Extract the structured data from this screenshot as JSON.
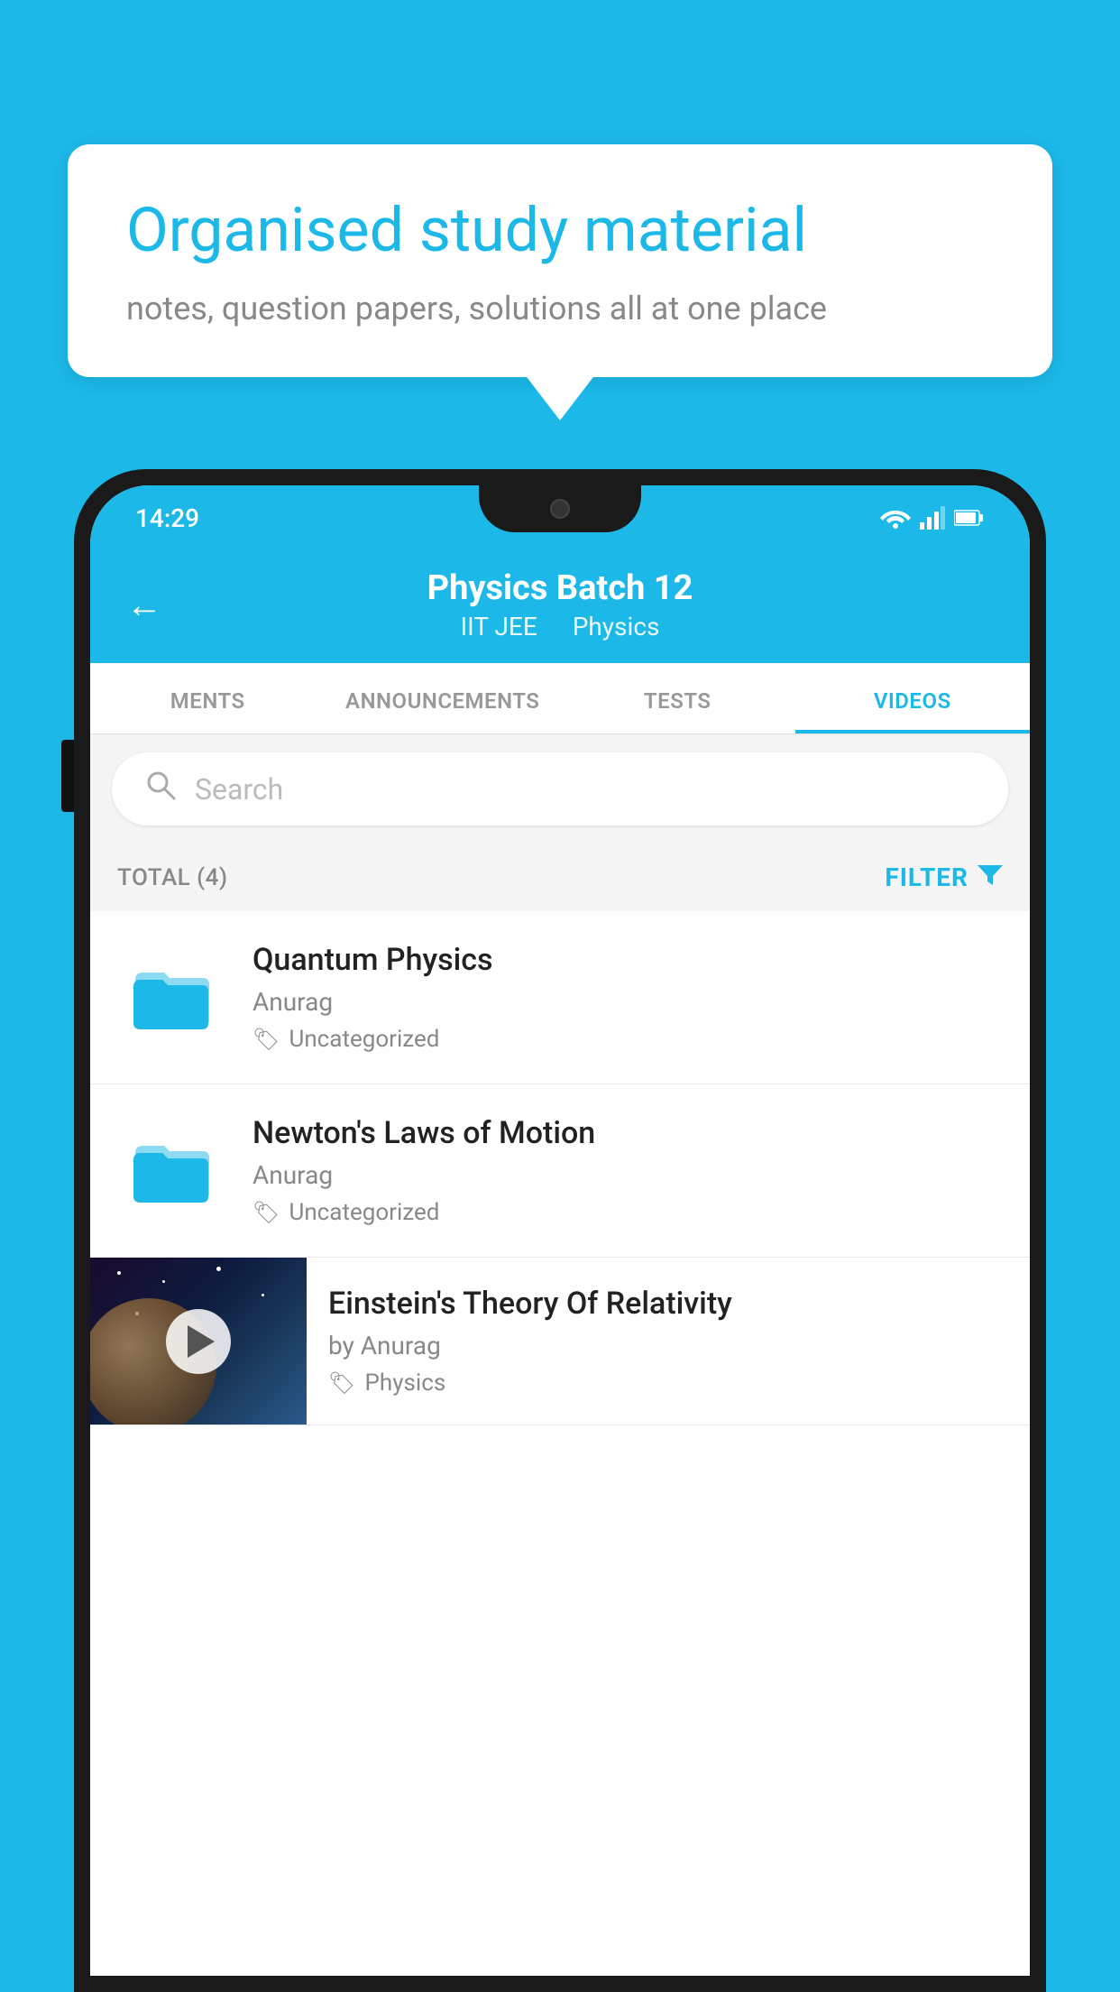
{
  "background": {
    "color": "#1BB8E8"
  },
  "speech_bubble": {
    "heading": "Organised study material",
    "subtext": "notes, question papers, solutions all at one place"
  },
  "phone": {
    "status_bar": {
      "time": "14:29",
      "icons": [
        "wifi",
        "signal",
        "battery"
      ]
    },
    "header": {
      "title": "Physics Batch 12",
      "subtitle_part1": "IIT JEE",
      "subtitle_part2": "Physics",
      "back_label": "←"
    },
    "tabs": [
      {
        "label": "MENTS",
        "active": false
      },
      {
        "label": "ANNOUNCEMENTS",
        "active": false
      },
      {
        "label": "TESTS",
        "active": false
      },
      {
        "label": "VIDEOS",
        "active": true
      }
    ],
    "search": {
      "placeholder": "Search"
    },
    "filter_bar": {
      "total_label": "TOTAL (4)",
      "filter_label": "FILTER"
    },
    "videos": [
      {
        "id": 1,
        "title": "Quantum Physics",
        "author": "Anurag",
        "tag": "Uncategorized",
        "type": "folder",
        "has_thumbnail": false
      },
      {
        "id": 2,
        "title": "Newton's Laws of Motion",
        "author": "Anurag",
        "tag": "Uncategorized",
        "type": "folder",
        "has_thumbnail": false
      },
      {
        "id": 3,
        "title": "Einstein's Theory Of Relativity",
        "author": "by Anurag",
        "tag": "Physics",
        "type": "video",
        "has_thumbnail": true
      }
    ]
  }
}
